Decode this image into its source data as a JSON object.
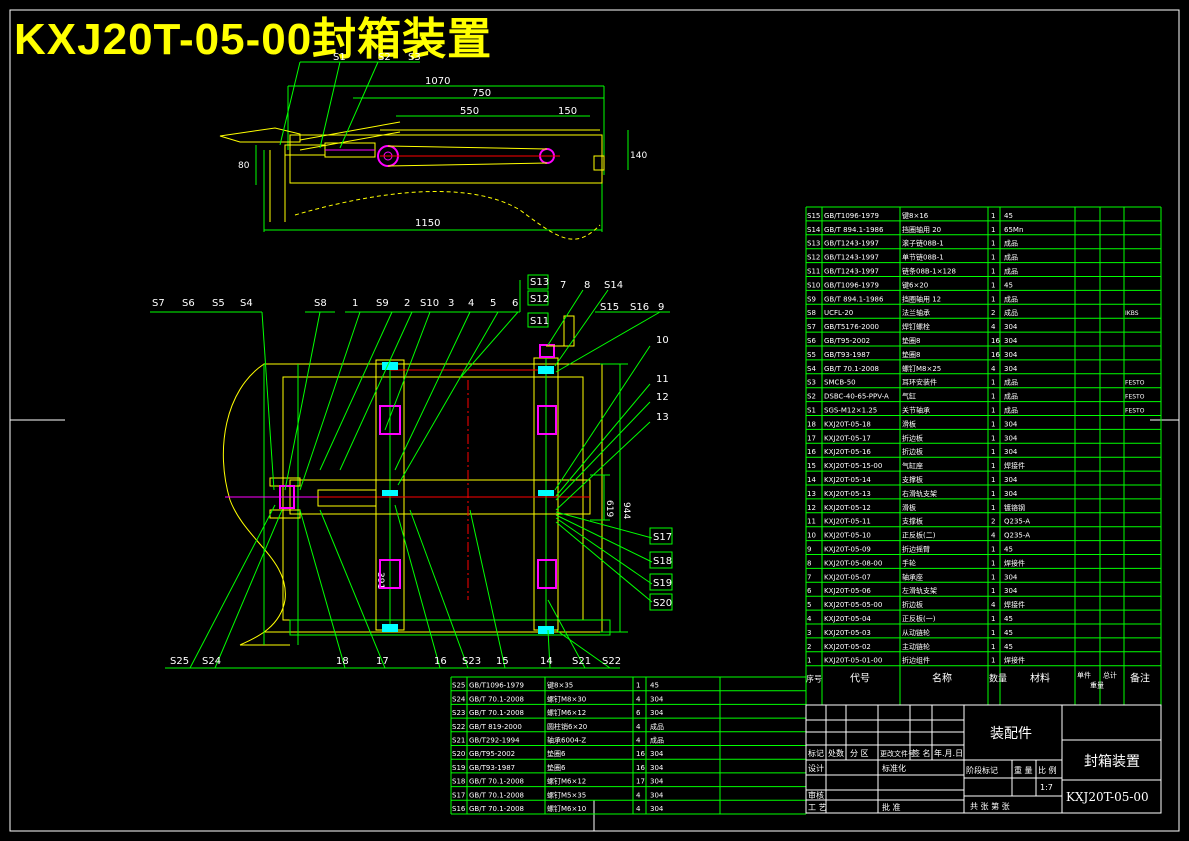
{
  "drawing": {
    "title": "KXJ20T-05-00封箱装置",
    "part_name": "封箱装置",
    "drawing_no": "KXJ20T-05-00",
    "assembly_label": "装配件",
    "scale": "1:7"
  },
  "top_view": {
    "dims": [
      "1070",
      "750",
      "550",
      "150",
      "1150",
      "80",
      "140"
    ],
    "callouts": [
      "S1",
      "S2",
      "S3"
    ]
  },
  "main_view": {
    "callouts_top": [
      "S7",
      "S6",
      "S5",
      "S4",
      "S8",
      "1",
      "S9",
      "2",
      "S10",
      "3",
      "4",
      "5",
      "6",
      "S13",
      "7",
      "8",
      "S14",
      "S12",
      "S11",
      "S15",
      "S16",
      "9"
    ],
    "callouts_right": [
      "10",
      "11",
      "12",
      "13",
      "S17",
      "S18",
      "S19",
      "S20"
    ],
    "callouts_bottom": [
      "S25",
      "S24",
      "18",
      "17",
      "16",
      "S23",
      "15",
      "14",
      "S21",
      "S22"
    ],
    "dims": [
      "944",
      "619",
      "391"
    ]
  },
  "bom_right": {
    "headers": [
      "序号",
      "代号",
      "名称",
      "数量",
      "材料",
      "单件",
      "总计",
      "备注"
    ],
    "header_sub": "重量",
    "rows": [
      [
        "S15",
        "GB/T1096-1979",
        "键8×16",
        "1",
        "45",
        ""
      ],
      [
        "S14",
        "GB/T 894.1-1986",
        "挡圈轴用 20",
        "1",
        "65Mn",
        ""
      ],
      [
        "S13",
        "GB/T1243-1997",
        "滚子链08B-1",
        "1",
        "成品",
        ""
      ],
      [
        "S12",
        "GB/T1243-1997",
        "单节链08B-1",
        "1",
        "成品",
        ""
      ],
      [
        "S11",
        "GB/T1243-1997",
        "链条08B-1×128",
        "1",
        "成品",
        ""
      ],
      [
        "S10",
        "GB/T1096-1979",
        "键6×20",
        "1",
        "45",
        ""
      ],
      [
        "S9",
        "GB/T 894.1-1986",
        "挡圈轴用 12",
        "1",
        "成品",
        ""
      ],
      [
        "S8",
        "UCFL-20",
        "法兰轴承",
        "2",
        "成品",
        "IKBS"
      ],
      [
        "S7",
        "GB/T5176-2000",
        "焊钉螺栓",
        "4",
        "304",
        ""
      ],
      [
        "S6",
        "GB/T95-2002",
        "垫圈8",
        "16",
        "304",
        ""
      ],
      [
        "S5",
        "GB/T93-1987",
        "垫圈8",
        "16",
        "304",
        ""
      ],
      [
        "S4",
        "GB/T 70.1-2008",
        "螺钉M8×25",
        "4",
        "304",
        ""
      ],
      [
        "S3",
        "SMCB-50",
        "耳环安装件",
        "1",
        "成品",
        "FESTO"
      ],
      [
        "S2",
        "DSBC-40-65-PPV-A",
        "气缸",
        "1",
        "成品",
        "FESTO"
      ],
      [
        "S1",
        "SGS-M12×1.25",
        "关节轴承",
        "1",
        "成品",
        "FESTO"
      ],
      [
        "18",
        "KXJ20T-05-18",
        "滑板",
        "1",
        "304",
        ""
      ],
      [
        "17",
        "KXJ20T-05-17",
        "折边板",
        "1",
        "304",
        ""
      ],
      [
        "16",
        "KXJ20T-05-16",
        "折边板",
        "1",
        "304",
        ""
      ],
      [
        "15",
        "KXJ20T-05-15-00",
        "气缸座",
        "1",
        "焊接件",
        ""
      ],
      [
        "14",
        "KXJ20T-05-14",
        "支撑板",
        "1",
        "304",
        ""
      ],
      [
        "13",
        "KXJ20T-05-13",
        "右滑轨支架",
        "1",
        "304",
        ""
      ],
      [
        "12",
        "KXJ20T-05-12",
        "滑板",
        "1",
        "镀铬钢",
        ""
      ],
      [
        "11",
        "KXJ20T-05-11",
        "支撑板",
        "2",
        "Q235-A",
        ""
      ],
      [
        "10",
        "KXJ20T-05-10",
        "正反板(二)",
        "4",
        "Q235-A",
        ""
      ],
      [
        "9",
        "KXJ20T-05-09",
        "折边摇臂",
        "1",
        "45",
        ""
      ],
      [
        "8",
        "KXJ20T-05-08-00",
        "手轮",
        "1",
        "焊接件",
        ""
      ],
      [
        "7",
        "KXJ20T-05-07",
        "轴承座",
        "1",
        "304",
        ""
      ],
      [
        "6",
        "KXJ20T-05-06",
        "左滑轨支架",
        "1",
        "304",
        ""
      ],
      [
        "5",
        "KXJ20T-05-05-00",
        "折边板",
        "4",
        "焊接件",
        ""
      ],
      [
        "4",
        "KXJ20T-05-04",
        "正反板(一)",
        "1",
        "45",
        ""
      ],
      [
        "3",
        "KXJ20T-05-03",
        "从动链轮",
        "1",
        "45",
        ""
      ],
      [
        "2",
        "KXJ20T-05-02",
        "主动链轮",
        "1",
        "45",
        ""
      ],
      [
        "1",
        "KXJ20T-05-01-00",
        "折边组件",
        "1",
        "焊接件",
        ""
      ]
    ]
  },
  "bom_bottom": {
    "rows": [
      [
        "S25",
        "GB/T1096-1979",
        "键8×35",
        "1",
        "45"
      ],
      [
        "S24",
        "GB/T 70.1-2008",
        "螺钉M8×30",
        "4",
        "304"
      ],
      [
        "S23",
        "GB/T 70.1-2008",
        "螺钉M6×12",
        "6",
        "304"
      ],
      [
        "S22",
        "GB/T 819-2000",
        "圆柱销6×20",
        "4",
        "成品"
      ],
      [
        "S21",
        "GB/T292-1994",
        "轴承6004-Z",
        "4",
        "成品"
      ],
      [
        "S20",
        "GB/T95-2002",
        "垫圈6",
        "16",
        "304"
      ],
      [
        "S19",
        "GB/T93-1987",
        "垫圈6",
        "16",
        "304"
      ],
      [
        "S18",
        "GB/T 70.1-2008",
        "螺钉M6×12",
        "17",
        "304"
      ],
      [
        "S17",
        "GB/T 70.1-2008",
        "螺钉M5×35",
        "4",
        "304"
      ],
      [
        "S16",
        "GB/T 70.1-2008",
        "螺钉M6×10",
        "4",
        "304"
      ]
    ]
  },
  "title_block": {
    "row1": [
      "标记",
      "处数",
      "分 区",
      "更改文件号",
      "签 名",
      "年.月.日"
    ],
    "design": "设计",
    "standard": "标准化",
    "stage_row": [
      "阶段标记",
      "重 量",
      "比 例"
    ],
    "review": "审核",
    "process": "工 艺",
    "approve": "批 准",
    "sheet_row": "共 张 第 张"
  },
  "colors": {
    "frame": "#ffffff",
    "outline": "#00ff00",
    "part": "#ffff00",
    "center": "#ff0000",
    "accent": "#ff00ff",
    "title": "#ffff00"
  }
}
